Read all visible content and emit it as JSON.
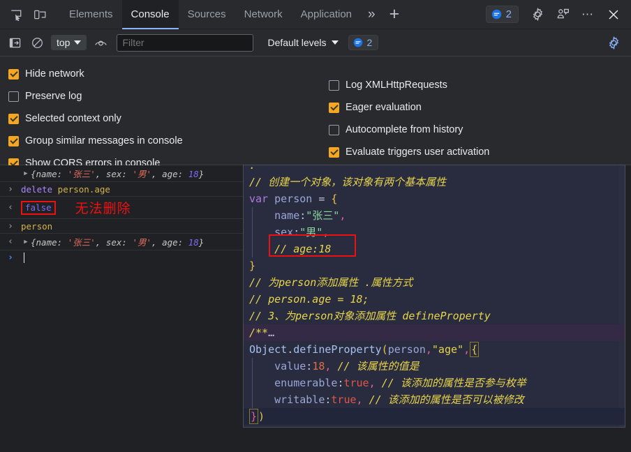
{
  "tabbar": {
    "icons": [
      {
        "name": "inspect-element-icon",
        "glyph": "inspect"
      },
      {
        "name": "device-toolbar-icon",
        "glyph": "device"
      }
    ],
    "tabs": [
      {
        "label": "Elements",
        "active": false
      },
      {
        "label": "Console",
        "active": true
      },
      {
        "label": "Sources",
        "active": false
      },
      {
        "label": "Network",
        "active": false
      },
      {
        "label": "Application",
        "active": false
      }
    ],
    "more_tabs": "»",
    "new_tab": "+",
    "message_count": "2",
    "settings_icon": "gear-icon",
    "feedback_icon": "feedback-icon",
    "overflow": "⋯",
    "close": "✕"
  },
  "filterbar": {
    "sidebar_toggle": "show-console-sidebar-icon",
    "clear_console": "clear-console-icon",
    "context": "top",
    "live_expression": "eye-icon",
    "filter_placeholder": "Filter",
    "filter_value": "",
    "levels": "Default levels",
    "message_count": "2",
    "settings_icon": "console-settings-icon"
  },
  "settings": {
    "left": [
      {
        "label": "Hide network",
        "checked": true
      },
      {
        "label": "Preserve log",
        "checked": false
      },
      {
        "label": "Selected context only",
        "checked": true
      },
      {
        "label": "Group similar messages in console",
        "checked": true
      },
      {
        "label": "Show CORS errors in console",
        "checked": true
      }
    ],
    "right": [
      {
        "label": "Log XMLHttpRequests",
        "checked": false
      },
      {
        "label": "Eager evaluation",
        "checked": true
      },
      {
        "label": "Autocomplete from history",
        "checked": false
      },
      {
        "label": "Evaluate triggers user activation",
        "checked": true
      }
    ]
  },
  "console": {
    "rows": [
      {
        "type": "result-object",
        "gutter": "",
        "expander": "▶",
        "text": "{name: '张三', sex: '男', age: 18}",
        "parts": {
          "open": "{",
          "k1": "name: ",
          "v1": "'张三'",
          "s1": ", ",
          "k2": "sex: ",
          "v2": "'男'",
          "s2": ", ",
          "k3": "age: ",
          "v3": "18",
          "close": "}"
        }
      },
      {
        "type": "input",
        "gutter": "›",
        "keyword": "delete",
        "expr": " person.age"
      },
      {
        "type": "result-boxed",
        "gutter": "‹",
        "value": "false",
        "annotation": "无法删除"
      },
      {
        "type": "input",
        "gutter": "›",
        "keyword": "",
        "expr": "person"
      },
      {
        "type": "result-object",
        "gutter": "‹",
        "expander": "▶",
        "parts": {
          "open": "{",
          "k1": "name: ",
          "v1": "'张三'",
          "s1": ", ",
          "k2": "sex: ",
          "v2": "'男'",
          "s2": ", ",
          "k3": "age: ",
          "v3": "18",
          "close": "}"
        }
      },
      {
        "type": "prompt",
        "gutter": "›",
        "value": ""
      }
    ]
  },
  "editor": {
    "lines": [
      {
        "id": "l0",
        "kind": "partial",
        "segments": [
          {
            "c": "c-cmt",
            "t": "."
          }
        ]
      },
      {
        "id": "l1",
        "kind": "code",
        "segments": [
          {
            "c": "c-cmt",
            "t": "// 创建一个对象，该对象有两个基本属性"
          }
        ]
      },
      {
        "id": "l2",
        "kind": "code",
        "segments": [
          {
            "c": "c-kw",
            "t": "var"
          },
          {
            "c": "c-op",
            "t": " "
          },
          {
            "c": "c-var",
            "t": "person"
          },
          {
            "c": "c-op",
            "t": " = "
          },
          {
            "c": "c-brace",
            "t": "{"
          }
        ]
      },
      {
        "id": "l3",
        "kind": "code",
        "indent": true,
        "segments": [
          {
            "c": "c-op",
            "t": "    "
          },
          {
            "c": "c-prop",
            "t": "name"
          },
          {
            "c": "c-op",
            "t": ":"
          },
          {
            "c": "c-str",
            "t": "\"张三\""
          },
          {
            "c": "c-pink",
            "t": ","
          }
        ]
      },
      {
        "id": "l4",
        "kind": "code",
        "indent": true,
        "segments": [
          {
            "c": "c-op",
            "t": "    "
          },
          {
            "c": "c-prop",
            "t": "sex"
          },
          {
            "c": "c-op",
            "t": ":"
          },
          {
            "c": "c-str",
            "t": "\"男\""
          },
          {
            "c": "c-pink",
            "t": ","
          }
        ]
      },
      {
        "id": "l5",
        "kind": "code",
        "indent": true,
        "segments": [
          {
            "c": "c-op",
            "t": "    "
          },
          {
            "c": "c-cmt",
            "t": "// age:18"
          }
        ]
      },
      {
        "id": "l6",
        "kind": "code",
        "segments": [
          {
            "c": "c-brace",
            "t": "}"
          }
        ]
      },
      {
        "id": "l7",
        "kind": "code",
        "segments": [
          {
            "c": "c-cmt",
            "t": "// 为person添加属性 .属性方式"
          }
        ]
      },
      {
        "id": "l8",
        "kind": "code",
        "segments": [
          {
            "c": "c-cmt",
            "t": "// person.age = 18;"
          }
        ]
      },
      {
        "id": "l9",
        "kind": "code",
        "segments": [
          {
            "c": "c-cmt",
            "t": "// 3、为person对象添加属性 defineProperty"
          }
        ]
      },
      {
        "id": "l10",
        "kind": "fold",
        "segments": [
          {
            "c": "c-cmt",
            "t": "/**"
          },
          {
            "c": "c-op",
            "t": "…"
          }
        ]
      },
      {
        "id": "l11",
        "kind": "code",
        "segments": [
          {
            "c": "c-fn",
            "t": "Object"
          },
          {
            "c": "c-op",
            "t": "."
          },
          {
            "c": "c-fn",
            "t": "defineProperty"
          },
          {
            "c": "c-paren",
            "t": "("
          },
          {
            "c": "c-var",
            "t": "person"
          },
          {
            "c": "c-pink",
            "t": ","
          },
          {
            "c": "c-strq",
            "t": "\"age\""
          },
          {
            "c": "c-pink",
            "t": ","
          }
        ]
      },
      {
        "id": "l12",
        "kind": "code",
        "indent": true,
        "segments": [
          {
            "c": "c-op",
            "t": "    "
          },
          {
            "c": "c-prop",
            "t": "value"
          },
          {
            "c": "c-op",
            "t": ":"
          },
          {
            "c": "c-num",
            "t": "18"
          },
          {
            "c": "c-pink",
            "t": ","
          },
          {
            "c": "c-op",
            "t": " "
          },
          {
            "c": "c-cmt",
            "t": "// 该属性的值是"
          }
        ]
      },
      {
        "id": "l13",
        "kind": "code",
        "indent": true,
        "segments": [
          {
            "c": "c-op",
            "t": "    "
          },
          {
            "c": "c-prop",
            "t": "enumerable"
          },
          {
            "c": "c-op",
            "t": ":"
          },
          {
            "c": "c-bool",
            "t": "true"
          },
          {
            "c": "c-pink",
            "t": ","
          },
          {
            "c": "c-op",
            "t": " "
          },
          {
            "c": "c-cmt",
            "t": "// 该添加的属性是否参与枚举"
          }
        ]
      },
      {
        "id": "l14",
        "kind": "code",
        "indent": true,
        "segments": [
          {
            "c": "c-op",
            "t": "    "
          },
          {
            "c": "c-prop",
            "t": "writable"
          },
          {
            "c": "c-op",
            "t": ":"
          },
          {
            "c": "c-bool",
            "t": "true"
          },
          {
            "c": "c-pink",
            "t": ","
          },
          {
            "c": "c-op",
            "t": " "
          },
          {
            "c": "c-cmt",
            "t": "// 该添加的属性是否可以被修改"
          }
        ]
      },
      {
        "id": "l15",
        "kind": "last",
        "segments": [
          {
            "c": "c-pink",
            "t": "}",
            "box": true
          },
          {
            "c": "c-paren",
            "t": ")"
          }
        ]
      }
    ]
  },
  "colors": {
    "accent": "#8ab4f8",
    "checkbox_on": "#f5a623",
    "annotation_red": "#ee1111",
    "editor_bg": "#282c3e",
    "panel_bg": "#292a2d",
    "console_bg": "#202124"
  }
}
